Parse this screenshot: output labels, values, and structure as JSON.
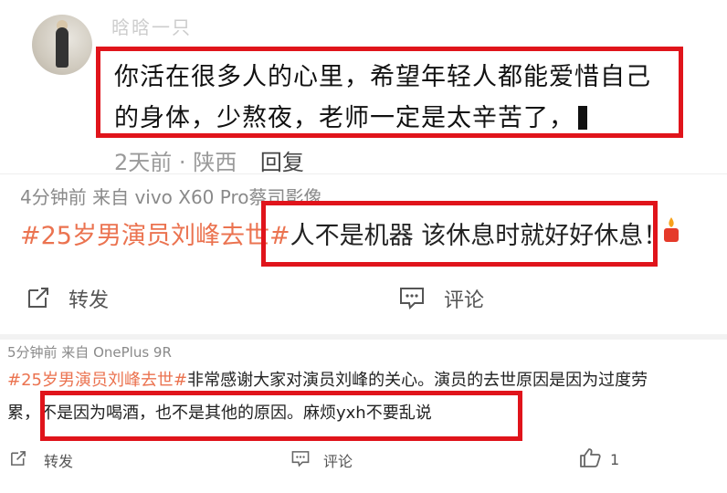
{
  "comment_top": {
    "username": "晗晗一只",
    "text_line1": "你活在很多人的心里，希望年轻人都能爱惜自己",
    "text_line2": "的身体，少熬夜，老师一定是太辛苦了，",
    "time": "2天前",
    "separator": "·",
    "location": "陕西",
    "reply_label": "回复"
  },
  "post_mid": {
    "meta": "4分钟前  来自 vivo X60 Pro蔡司影像",
    "hashtag": "#25岁男演员刘峰去世#",
    "text": "人不是机器 该休息时就好好休息！",
    "repost_label": "转发",
    "comment_label": "评论"
  },
  "post_bottom": {
    "meta": "5分钟前  来自 OnePlus 9R",
    "hashtag": "#25岁男演员刘峰去世#",
    "text_line1": "非常感谢大家对演员刘峰的关心。演员的去世原因是因为过度劳",
    "text_line2": "累，不是因为喝酒，也不是其他的原因。麻烦yxh不要乱说",
    "repost_label": "转发",
    "comment_label": "评论",
    "like_count": "1"
  },
  "colors": {
    "highlight_box": "#e0141b",
    "hashtag": "#eb7350",
    "meta_gray": "#8a8a8a"
  }
}
